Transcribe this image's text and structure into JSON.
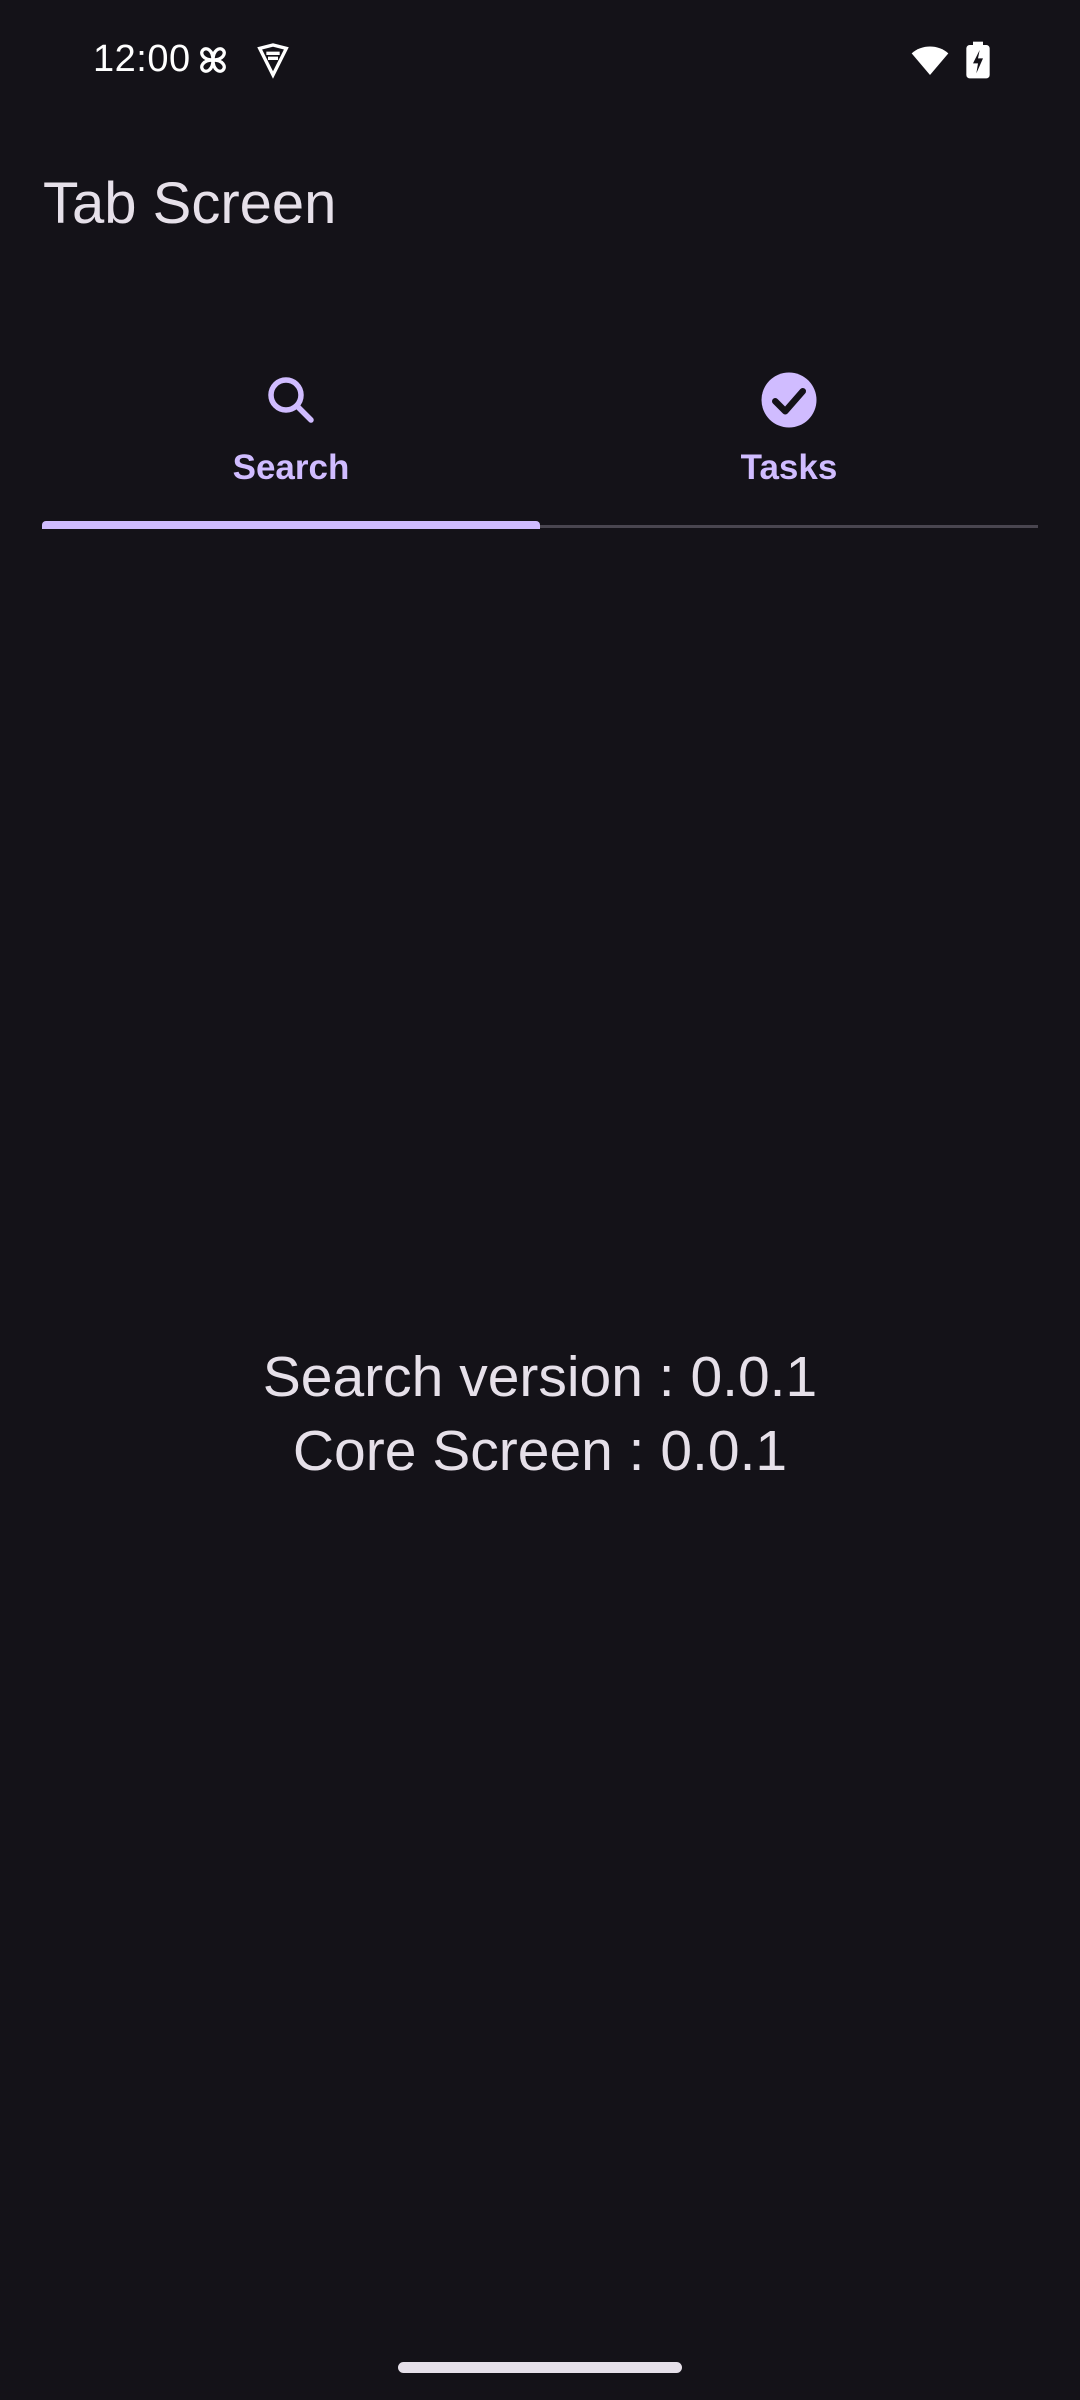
{
  "status_bar": {
    "time": "12:00",
    "icons": [
      "pinwheel-icon",
      "shield-icon",
      "wifi-icon",
      "battery-charging-icon"
    ]
  },
  "app_bar": {
    "title": "Tab Screen"
  },
  "tabs": [
    {
      "label": "Search",
      "icon": "search-icon",
      "selected": true
    },
    {
      "label": "Tasks",
      "icon": "check-circle-icon",
      "selected": false
    }
  ],
  "content": {
    "lines": [
      "Search version : 0.0.1",
      "Core Screen : 0.0.1"
    ]
  },
  "colors": {
    "background": "#141218",
    "accent": "#d0bcff",
    "on_surface": "#e6e0e9",
    "divider": "#49454f"
  }
}
